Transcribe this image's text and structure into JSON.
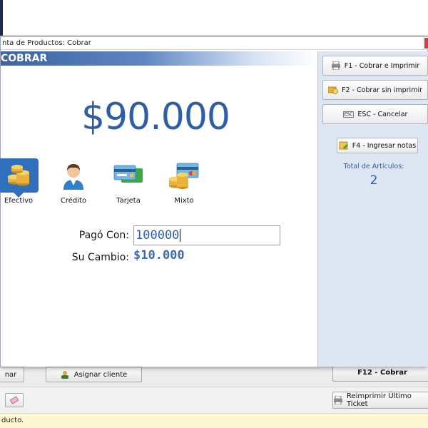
{
  "modal": {
    "title": "nta de Productos: Cobrar",
    "header": "COBRAR",
    "total": "$90.000",
    "payment_methods": [
      {
        "label": "Efectivo",
        "icon": "coins-icon",
        "selected": true
      },
      {
        "label": "Crédito",
        "icon": "person-icon",
        "selected": false
      },
      {
        "label": "Tarjeta",
        "icon": "credit-cards-icon",
        "selected": false
      },
      {
        "label": "Mixto",
        "icon": "coins-card-icon",
        "selected": false
      }
    ],
    "pago_label": "Pagó Con:",
    "pago_value": "100000",
    "cambio_label": "Su Cambio:",
    "cambio_value": "$10.000"
  },
  "actions": {
    "f1": "F1 - Cobrar e Imprimir",
    "f2": "F2 - Cobrar sin imprimir",
    "esc": "ESC - Cancelar",
    "f4": "F4 - Ingresar notas",
    "esc_key": "ESC"
  },
  "summary": {
    "total_articulos_label": "Total de Artículos:",
    "total_articulos_value": "2"
  },
  "background": {
    "btn_partial": "nar",
    "asignar_cliente": "Asignar cliente",
    "f12_partial": "F12 - Cobrar",
    "reimprimir": "Reimprimir Último Ticket",
    "status": "ducto."
  },
  "colors": {
    "accent_blue": "#2f5da7",
    "selected_method": "#2f6fbb",
    "side_panel": "#dde7f3",
    "status_bar": "#fdf8d2"
  }
}
